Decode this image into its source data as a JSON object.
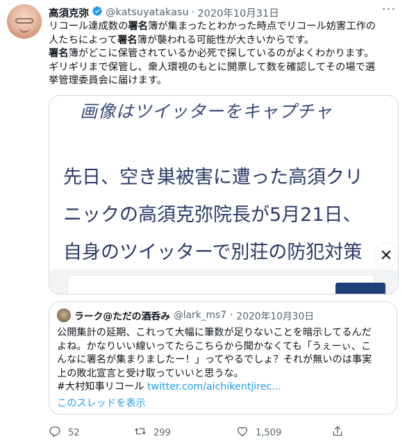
{
  "tweet": {
    "author_name": "高須克弥",
    "handle": "@katsuyatakasu",
    "separator": "·",
    "date": "2020年10月31日",
    "more_label": "···",
    "segments": [
      {
        "text": "リコール達成数の",
        "bold": false
      },
      {
        "text": "署名",
        "bold": true
      },
      {
        "text": "簿が集まったとわかった時点でリコール妨害工作の\n人たちによって",
        "bold": false
      },
      {
        "text": "署名",
        "bold": true
      },
      {
        "text": "簿が襲われる可能性が大きいからです。\n",
        "bold": false
      },
      {
        "text": "署名",
        "bold": true
      },
      {
        "text": "簿がどこに保管されているか必死で探しているのがよくわかります。\nギリギリまで保管し、衆人環視のもとに開票して数を確認してその場で選\n挙管理委員会に届けます。",
        "bold": false
      }
    ]
  },
  "media": {
    "lines": [
      "画像はツイッターをキャプチャ",
      "先日、空き巣被害に遭った高須クリ",
      "ニックの高須克弥院長が5月21日、",
      "自身のツイッターで別荘の防犯対策"
    ]
  },
  "quote": {
    "author_name": "ラーク@ただの酒呑み",
    "handle": "@lark_ms7",
    "separator": "·",
    "date": "2020年10月30日",
    "text": "公開集計の延期、これって大幅に筆数が足りないことを暗示してるんだ\nよね。かなりいい線いってたらこちらから聞かなくても「うぇーぃ、こ\nんなに署名が集まりましたー！」ってやるでしょ？それが無いのは事実\n上の敗北宣言と受け取っていいと思うな。\n#大村知事リコール ",
    "link": "twitter.com/aichikentjirec...",
    "show_thread": "このスレッドを表示"
  },
  "actions": {
    "replies": "52",
    "retweets": "299",
    "likes": "1,509"
  },
  "colors": {
    "accent": "#1d9bf0",
    "secondary_text": "#536471",
    "border": "#cfd9de"
  }
}
